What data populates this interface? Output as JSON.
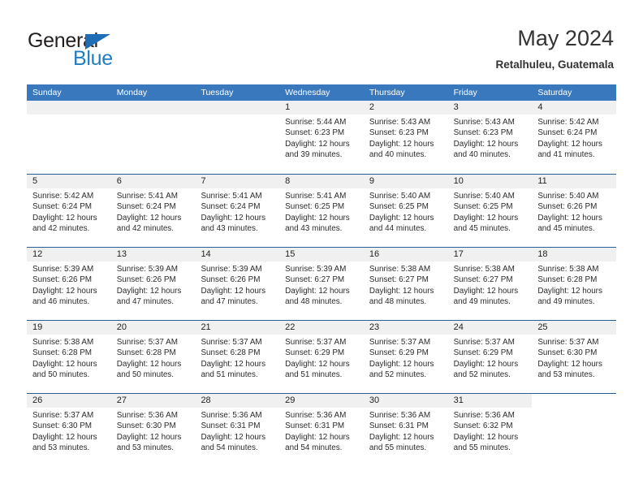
{
  "brand": {
    "name_part1": "General",
    "name_part2": "Blue",
    "triangle_color": "#1f6eb5",
    "blue_color": "#1f7dc4"
  },
  "header": {
    "title": "May 2024",
    "subtitle": "Retalhuleu, Guatemala"
  },
  "theme": {
    "header_blue": "#3a78bd",
    "daynum_gray": "#f0f0f0",
    "row_divider": "#2a5f96"
  },
  "weekdays": [
    "Sunday",
    "Monday",
    "Tuesday",
    "Wednesday",
    "Thursday",
    "Friday",
    "Saturday"
  ],
  "weeks": [
    [
      {
        "day": "",
        "sunrise": "",
        "sunset": "",
        "daylight_line1": "",
        "daylight_line2": ""
      },
      {
        "day": "",
        "sunrise": "",
        "sunset": "",
        "daylight_line1": "",
        "daylight_line2": ""
      },
      {
        "day": "",
        "sunrise": "",
        "sunset": "",
        "daylight_line1": "",
        "daylight_line2": ""
      },
      {
        "day": "1",
        "sunrise": "Sunrise: 5:44 AM",
        "sunset": "Sunset: 6:23 PM",
        "daylight_line1": "Daylight: 12 hours",
        "daylight_line2": "and 39 minutes."
      },
      {
        "day": "2",
        "sunrise": "Sunrise: 5:43 AM",
        "sunset": "Sunset: 6:23 PM",
        "daylight_line1": "Daylight: 12 hours",
        "daylight_line2": "and 40 minutes."
      },
      {
        "day": "3",
        "sunrise": "Sunrise: 5:43 AM",
        "sunset": "Sunset: 6:23 PM",
        "daylight_line1": "Daylight: 12 hours",
        "daylight_line2": "and 40 minutes."
      },
      {
        "day": "4",
        "sunrise": "Sunrise: 5:42 AM",
        "sunset": "Sunset: 6:24 PM",
        "daylight_line1": "Daylight: 12 hours",
        "daylight_line2": "and 41 minutes."
      }
    ],
    [
      {
        "day": "5",
        "sunrise": "Sunrise: 5:42 AM",
        "sunset": "Sunset: 6:24 PM",
        "daylight_line1": "Daylight: 12 hours",
        "daylight_line2": "and 42 minutes."
      },
      {
        "day": "6",
        "sunrise": "Sunrise: 5:41 AM",
        "sunset": "Sunset: 6:24 PM",
        "daylight_line1": "Daylight: 12 hours",
        "daylight_line2": "and 42 minutes."
      },
      {
        "day": "7",
        "sunrise": "Sunrise: 5:41 AM",
        "sunset": "Sunset: 6:24 PM",
        "daylight_line1": "Daylight: 12 hours",
        "daylight_line2": "and 43 minutes."
      },
      {
        "day": "8",
        "sunrise": "Sunrise: 5:41 AM",
        "sunset": "Sunset: 6:25 PM",
        "daylight_line1": "Daylight: 12 hours",
        "daylight_line2": "and 43 minutes."
      },
      {
        "day": "9",
        "sunrise": "Sunrise: 5:40 AM",
        "sunset": "Sunset: 6:25 PM",
        "daylight_line1": "Daylight: 12 hours",
        "daylight_line2": "and 44 minutes."
      },
      {
        "day": "10",
        "sunrise": "Sunrise: 5:40 AM",
        "sunset": "Sunset: 6:25 PM",
        "daylight_line1": "Daylight: 12 hours",
        "daylight_line2": "and 45 minutes."
      },
      {
        "day": "11",
        "sunrise": "Sunrise: 5:40 AM",
        "sunset": "Sunset: 6:26 PM",
        "daylight_line1": "Daylight: 12 hours",
        "daylight_line2": "and 45 minutes."
      }
    ],
    [
      {
        "day": "12",
        "sunrise": "Sunrise: 5:39 AM",
        "sunset": "Sunset: 6:26 PM",
        "daylight_line1": "Daylight: 12 hours",
        "daylight_line2": "and 46 minutes."
      },
      {
        "day": "13",
        "sunrise": "Sunrise: 5:39 AM",
        "sunset": "Sunset: 6:26 PM",
        "daylight_line1": "Daylight: 12 hours",
        "daylight_line2": "and 47 minutes."
      },
      {
        "day": "14",
        "sunrise": "Sunrise: 5:39 AM",
        "sunset": "Sunset: 6:26 PM",
        "daylight_line1": "Daylight: 12 hours",
        "daylight_line2": "and 47 minutes."
      },
      {
        "day": "15",
        "sunrise": "Sunrise: 5:39 AM",
        "sunset": "Sunset: 6:27 PM",
        "daylight_line1": "Daylight: 12 hours",
        "daylight_line2": "and 48 minutes."
      },
      {
        "day": "16",
        "sunrise": "Sunrise: 5:38 AM",
        "sunset": "Sunset: 6:27 PM",
        "daylight_line1": "Daylight: 12 hours",
        "daylight_line2": "and 48 minutes."
      },
      {
        "day": "17",
        "sunrise": "Sunrise: 5:38 AM",
        "sunset": "Sunset: 6:27 PM",
        "daylight_line1": "Daylight: 12 hours",
        "daylight_line2": "and 49 minutes."
      },
      {
        "day": "18",
        "sunrise": "Sunrise: 5:38 AM",
        "sunset": "Sunset: 6:28 PM",
        "daylight_line1": "Daylight: 12 hours",
        "daylight_line2": "and 49 minutes."
      }
    ],
    [
      {
        "day": "19",
        "sunrise": "Sunrise: 5:38 AM",
        "sunset": "Sunset: 6:28 PM",
        "daylight_line1": "Daylight: 12 hours",
        "daylight_line2": "and 50 minutes."
      },
      {
        "day": "20",
        "sunrise": "Sunrise: 5:37 AM",
        "sunset": "Sunset: 6:28 PM",
        "daylight_line1": "Daylight: 12 hours",
        "daylight_line2": "and 50 minutes."
      },
      {
        "day": "21",
        "sunrise": "Sunrise: 5:37 AM",
        "sunset": "Sunset: 6:28 PM",
        "daylight_line1": "Daylight: 12 hours",
        "daylight_line2": "and 51 minutes."
      },
      {
        "day": "22",
        "sunrise": "Sunrise: 5:37 AM",
        "sunset": "Sunset: 6:29 PM",
        "daylight_line1": "Daylight: 12 hours",
        "daylight_line2": "and 51 minutes."
      },
      {
        "day": "23",
        "sunrise": "Sunrise: 5:37 AM",
        "sunset": "Sunset: 6:29 PM",
        "daylight_line1": "Daylight: 12 hours",
        "daylight_line2": "and 52 minutes."
      },
      {
        "day": "24",
        "sunrise": "Sunrise: 5:37 AM",
        "sunset": "Sunset: 6:29 PM",
        "daylight_line1": "Daylight: 12 hours",
        "daylight_line2": "and 52 minutes."
      },
      {
        "day": "25",
        "sunrise": "Sunrise: 5:37 AM",
        "sunset": "Sunset: 6:30 PM",
        "daylight_line1": "Daylight: 12 hours",
        "daylight_line2": "and 53 minutes."
      }
    ],
    [
      {
        "day": "26",
        "sunrise": "Sunrise: 5:37 AM",
        "sunset": "Sunset: 6:30 PM",
        "daylight_line1": "Daylight: 12 hours",
        "daylight_line2": "and 53 minutes."
      },
      {
        "day": "27",
        "sunrise": "Sunrise: 5:36 AM",
        "sunset": "Sunset: 6:30 PM",
        "daylight_line1": "Daylight: 12 hours",
        "daylight_line2": "and 53 minutes."
      },
      {
        "day": "28",
        "sunrise": "Sunrise: 5:36 AM",
        "sunset": "Sunset: 6:31 PM",
        "daylight_line1": "Daylight: 12 hours",
        "daylight_line2": "and 54 minutes."
      },
      {
        "day": "29",
        "sunrise": "Sunrise: 5:36 AM",
        "sunset": "Sunset: 6:31 PM",
        "daylight_line1": "Daylight: 12 hours",
        "daylight_line2": "and 54 minutes."
      },
      {
        "day": "30",
        "sunrise": "Sunrise: 5:36 AM",
        "sunset": "Sunset: 6:31 PM",
        "daylight_line1": "Daylight: 12 hours",
        "daylight_line2": "and 55 minutes."
      },
      {
        "day": "31",
        "sunrise": "Sunrise: 5:36 AM",
        "sunset": "Sunset: 6:32 PM",
        "daylight_line1": "Daylight: 12 hours",
        "daylight_line2": "and 55 minutes."
      },
      {
        "day": "",
        "sunrise": "",
        "sunset": "",
        "daylight_line1": "",
        "daylight_line2": "",
        "blank": true
      }
    ]
  ]
}
